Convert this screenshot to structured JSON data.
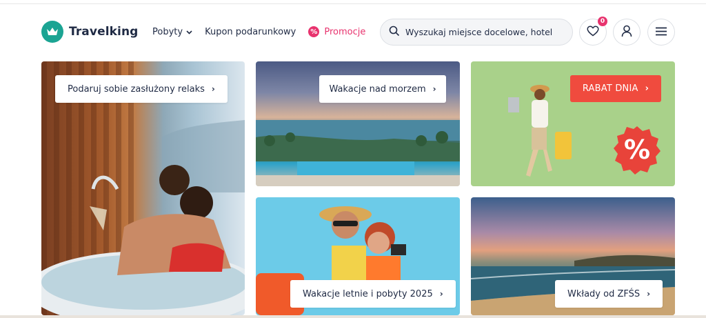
{
  "brand": {
    "name": "Travelking"
  },
  "nav": {
    "stays": "Pobyty",
    "voucher": "Kupon podarunkowy",
    "promo": "Promocje",
    "promo_icon": "%"
  },
  "search": {
    "placeholder": "Wyszukaj miejsce docelowe, hotel"
  },
  "favorites": {
    "count": "0"
  },
  "tiles": {
    "relax": "Podaruj sobie zasłużony relaks",
    "sea": "Wakacje nad morzem",
    "rabat": "RABAT DNIA",
    "rabat_symbol": "%",
    "summer": "Wakacje letnie i pobyty 2025",
    "zfss": "Wkłady od ZFŚS"
  },
  "colors": {
    "brand_teal": "#1ba493",
    "promo_pink": "#e8336e",
    "rabat_red": "#f04b3e",
    "text_dark": "#1f2a44"
  },
  "icons": {
    "logo": "crown-icon",
    "search": "search-icon",
    "favorites": "heart-icon",
    "account": "user-icon",
    "menu": "hamburger-menu-icon",
    "chevron": "chevron-right-icon"
  }
}
